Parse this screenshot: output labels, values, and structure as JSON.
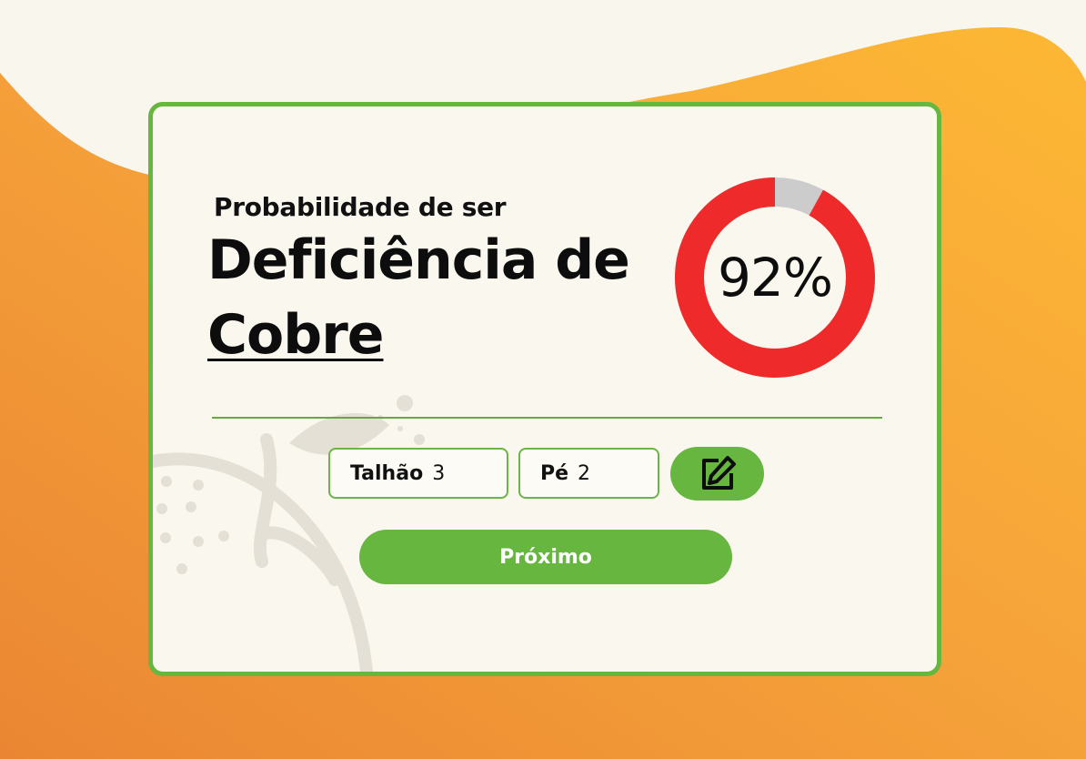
{
  "card": {
    "subtitle": "Probabilidade de ser",
    "title_line1": "Deficiência de",
    "title_line2": "Cobre"
  },
  "probability": {
    "value": 92,
    "label": "92%",
    "color_fill": "#ee2a2a",
    "color_rest": "#cccccc"
  },
  "selection": {
    "talhao_label": "Talhão",
    "talhao_value": "3",
    "pe_label": "Pé",
    "pe_value": "2",
    "edit_icon": "edit-icon"
  },
  "actions": {
    "next_label": "Próximo"
  },
  "colors": {
    "accent": "#66b640",
    "bg_orange": "#f29a3a",
    "bg_yellow": "#fdb734",
    "cream": "#faf7ef"
  }
}
